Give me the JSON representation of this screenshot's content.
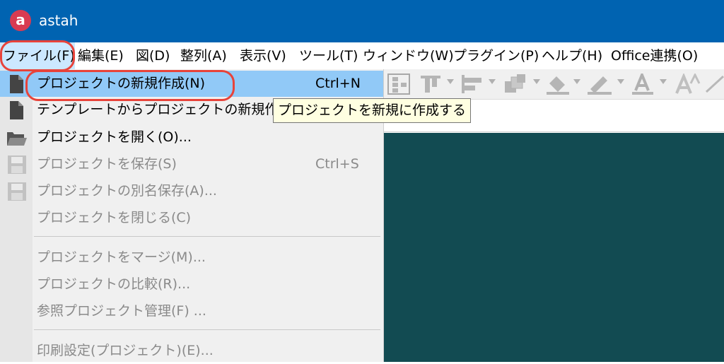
{
  "window": {
    "title": "astah",
    "logo_letter": "a"
  },
  "menubar": {
    "items": [
      {
        "label": "ファイル(F)"
      },
      {
        "label": "編集(E)"
      },
      {
        "label": "図(D)"
      },
      {
        "label": "整列(A)"
      },
      {
        "label": "表示(V)"
      },
      {
        "label": "ツール(T)"
      },
      {
        "label": "ウィンドウ(W)"
      },
      {
        "label": "プラグイン(P)"
      },
      {
        "label": "ヘルプ(H)"
      },
      {
        "label": "Office連携(O)"
      }
    ]
  },
  "file_menu": {
    "items": [
      {
        "label": "プロジェクトの新規作成(N)",
        "shortcut": "Ctrl+N",
        "enabled": true,
        "icon": "new-document-icon"
      },
      {
        "label": "テンプレートからプロジェクトの新規作",
        "shortcut": "",
        "enabled": true,
        "icon": "template-document-icon"
      },
      {
        "label": "プロジェクトを開く(O)...",
        "shortcut": "",
        "enabled": true,
        "icon": "open-folder-icon"
      },
      {
        "label": "プロジェクトを保存(S)",
        "shortcut": "Ctrl+S",
        "enabled": false,
        "icon": "save-icon"
      },
      {
        "label": "プロジェクトの別名保存(A)...",
        "shortcut": "",
        "enabled": false,
        "icon": "save-as-icon"
      },
      {
        "label": "プロジェクトを閉じる(C)",
        "shortcut": "",
        "enabled": false
      },
      {
        "label": "プロジェクトをマージ(M)...",
        "shortcut": "",
        "enabled": false
      },
      {
        "label": "プロジェクトの比較(R)...",
        "shortcut": "",
        "enabled": false
      },
      {
        "label": "参照プロジェクト管理(F) ...",
        "shortcut": "",
        "enabled": false
      },
      {
        "label": "印刷設定(プロジェクト)(E)...",
        "shortcut": "",
        "enabled": false
      }
    ]
  },
  "tooltip": {
    "text": "プロジェクトを新規に作成する"
  },
  "colors": {
    "titlebar": "#0063b1",
    "highlight": "#e8433a",
    "canvas": "#124b52",
    "hover": "#91c9f7"
  }
}
